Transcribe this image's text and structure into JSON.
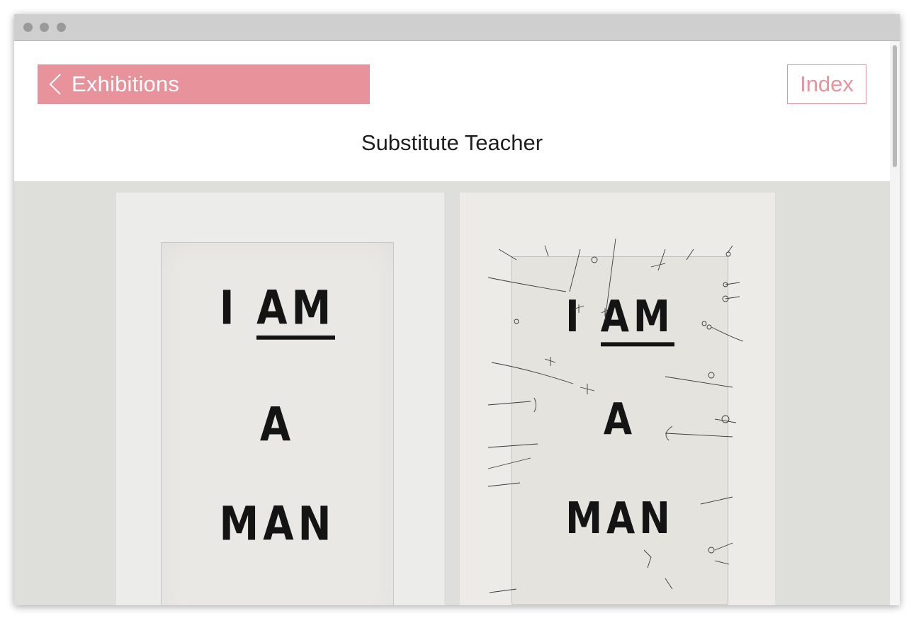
{
  "window": {
    "controls": [
      "close",
      "minimize",
      "maximize"
    ]
  },
  "nav": {
    "back_label": "Exhibitions",
    "back_icon": "chevron-left-icon",
    "index_label": "Index"
  },
  "page": {
    "title": "Substitute Teacher"
  },
  "artworks": [
    {
      "words": [
        "I AM",
        "A",
        "MAN"
      ],
      "kind": "painting"
    },
    {
      "words": [
        "I AM",
        "A",
        "MAN"
      ],
      "kind": "annotated-study"
    }
  ],
  "colors": {
    "accent": "#e8939b",
    "gallery_bg": "#dededb",
    "titlebar": "#cfcfcf"
  }
}
